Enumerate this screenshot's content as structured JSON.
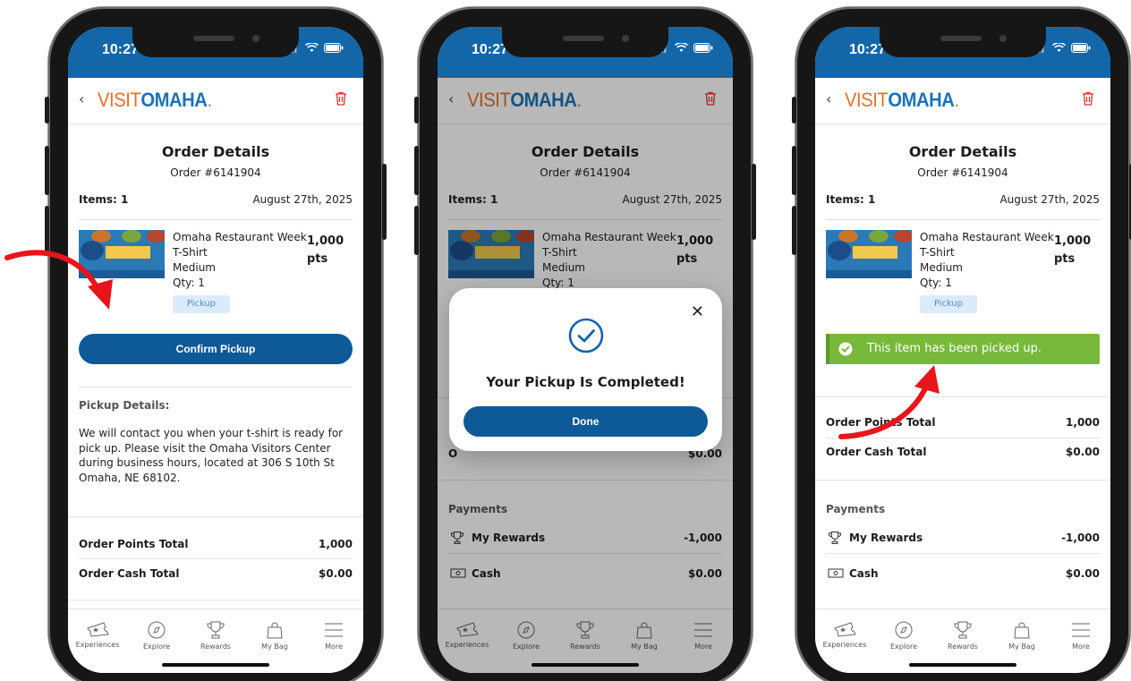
{
  "status": {
    "time": "10:27"
  },
  "brand": {
    "back": "‹",
    "logo_part1": "VISIT",
    "logo_part2": "OMAHA",
    "logo_dot": "."
  },
  "order": {
    "title": "Order Details",
    "number": "Order #6141904",
    "items_label": "Items: 1",
    "date": "August 27th, 2025",
    "product_name": "Omaha Restaurant Week",
    "product_type": "T-Shirt",
    "product_size": "Medium",
    "product_qty": "Qty: 1",
    "points_value": "1,000",
    "points_unit": "pts",
    "pickup_tag": "Pickup"
  },
  "screen1": {
    "confirm_button": "Confirm Pickup",
    "pickup_heading": "Pickup Details:",
    "pickup_text": "We will contact you when your t-shirt is ready for pick up. Please visit the Omaha Visitors Center during business hours, located at 306 S 10th St Omaha, NE 68102.",
    "points_total_label": "Order Points Total",
    "points_total_value": "1,000",
    "cash_total_label": "Order Cash Total",
    "cash_total_value": "$0.00"
  },
  "modal": {
    "close": "✕",
    "title": "Your Pickup Is Completed!",
    "done_button": "Done",
    "background_cash_value": "$0.00",
    "background_row_prefix": "O"
  },
  "screen3": {
    "success_message": "This item has been picked up.",
    "points_total_label": "Order Points Total",
    "points_total_value": "1,000",
    "cash_total_label": "Order Cash Total",
    "cash_total_value": "$0.00"
  },
  "payments": {
    "heading": "Payments",
    "rewards_label": "My Rewards",
    "rewards_value": "-1,000",
    "cash_label": "Cash",
    "cash_value": "$0.00"
  },
  "tabs": [
    {
      "label": "Experiences",
      "icon": "ticket-icon"
    },
    {
      "label": "Explore",
      "icon": "compass-icon"
    },
    {
      "label": "Rewards",
      "icon": "trophy-icon"
    },
    {
      "label": "My Bag",
      "icon": "bag-icon"
    },
    {
      "label": "More",
      "icon": "menu-icon"
    }
  ],
  "colors": {
    "header_blue": "#1366a8",
    "button_blue": "#0e5998",
    "success_green": "#78b83a",
    "arrow_red": "#e8141c",
    "logo_orange": "#e8702a"
  }
}
